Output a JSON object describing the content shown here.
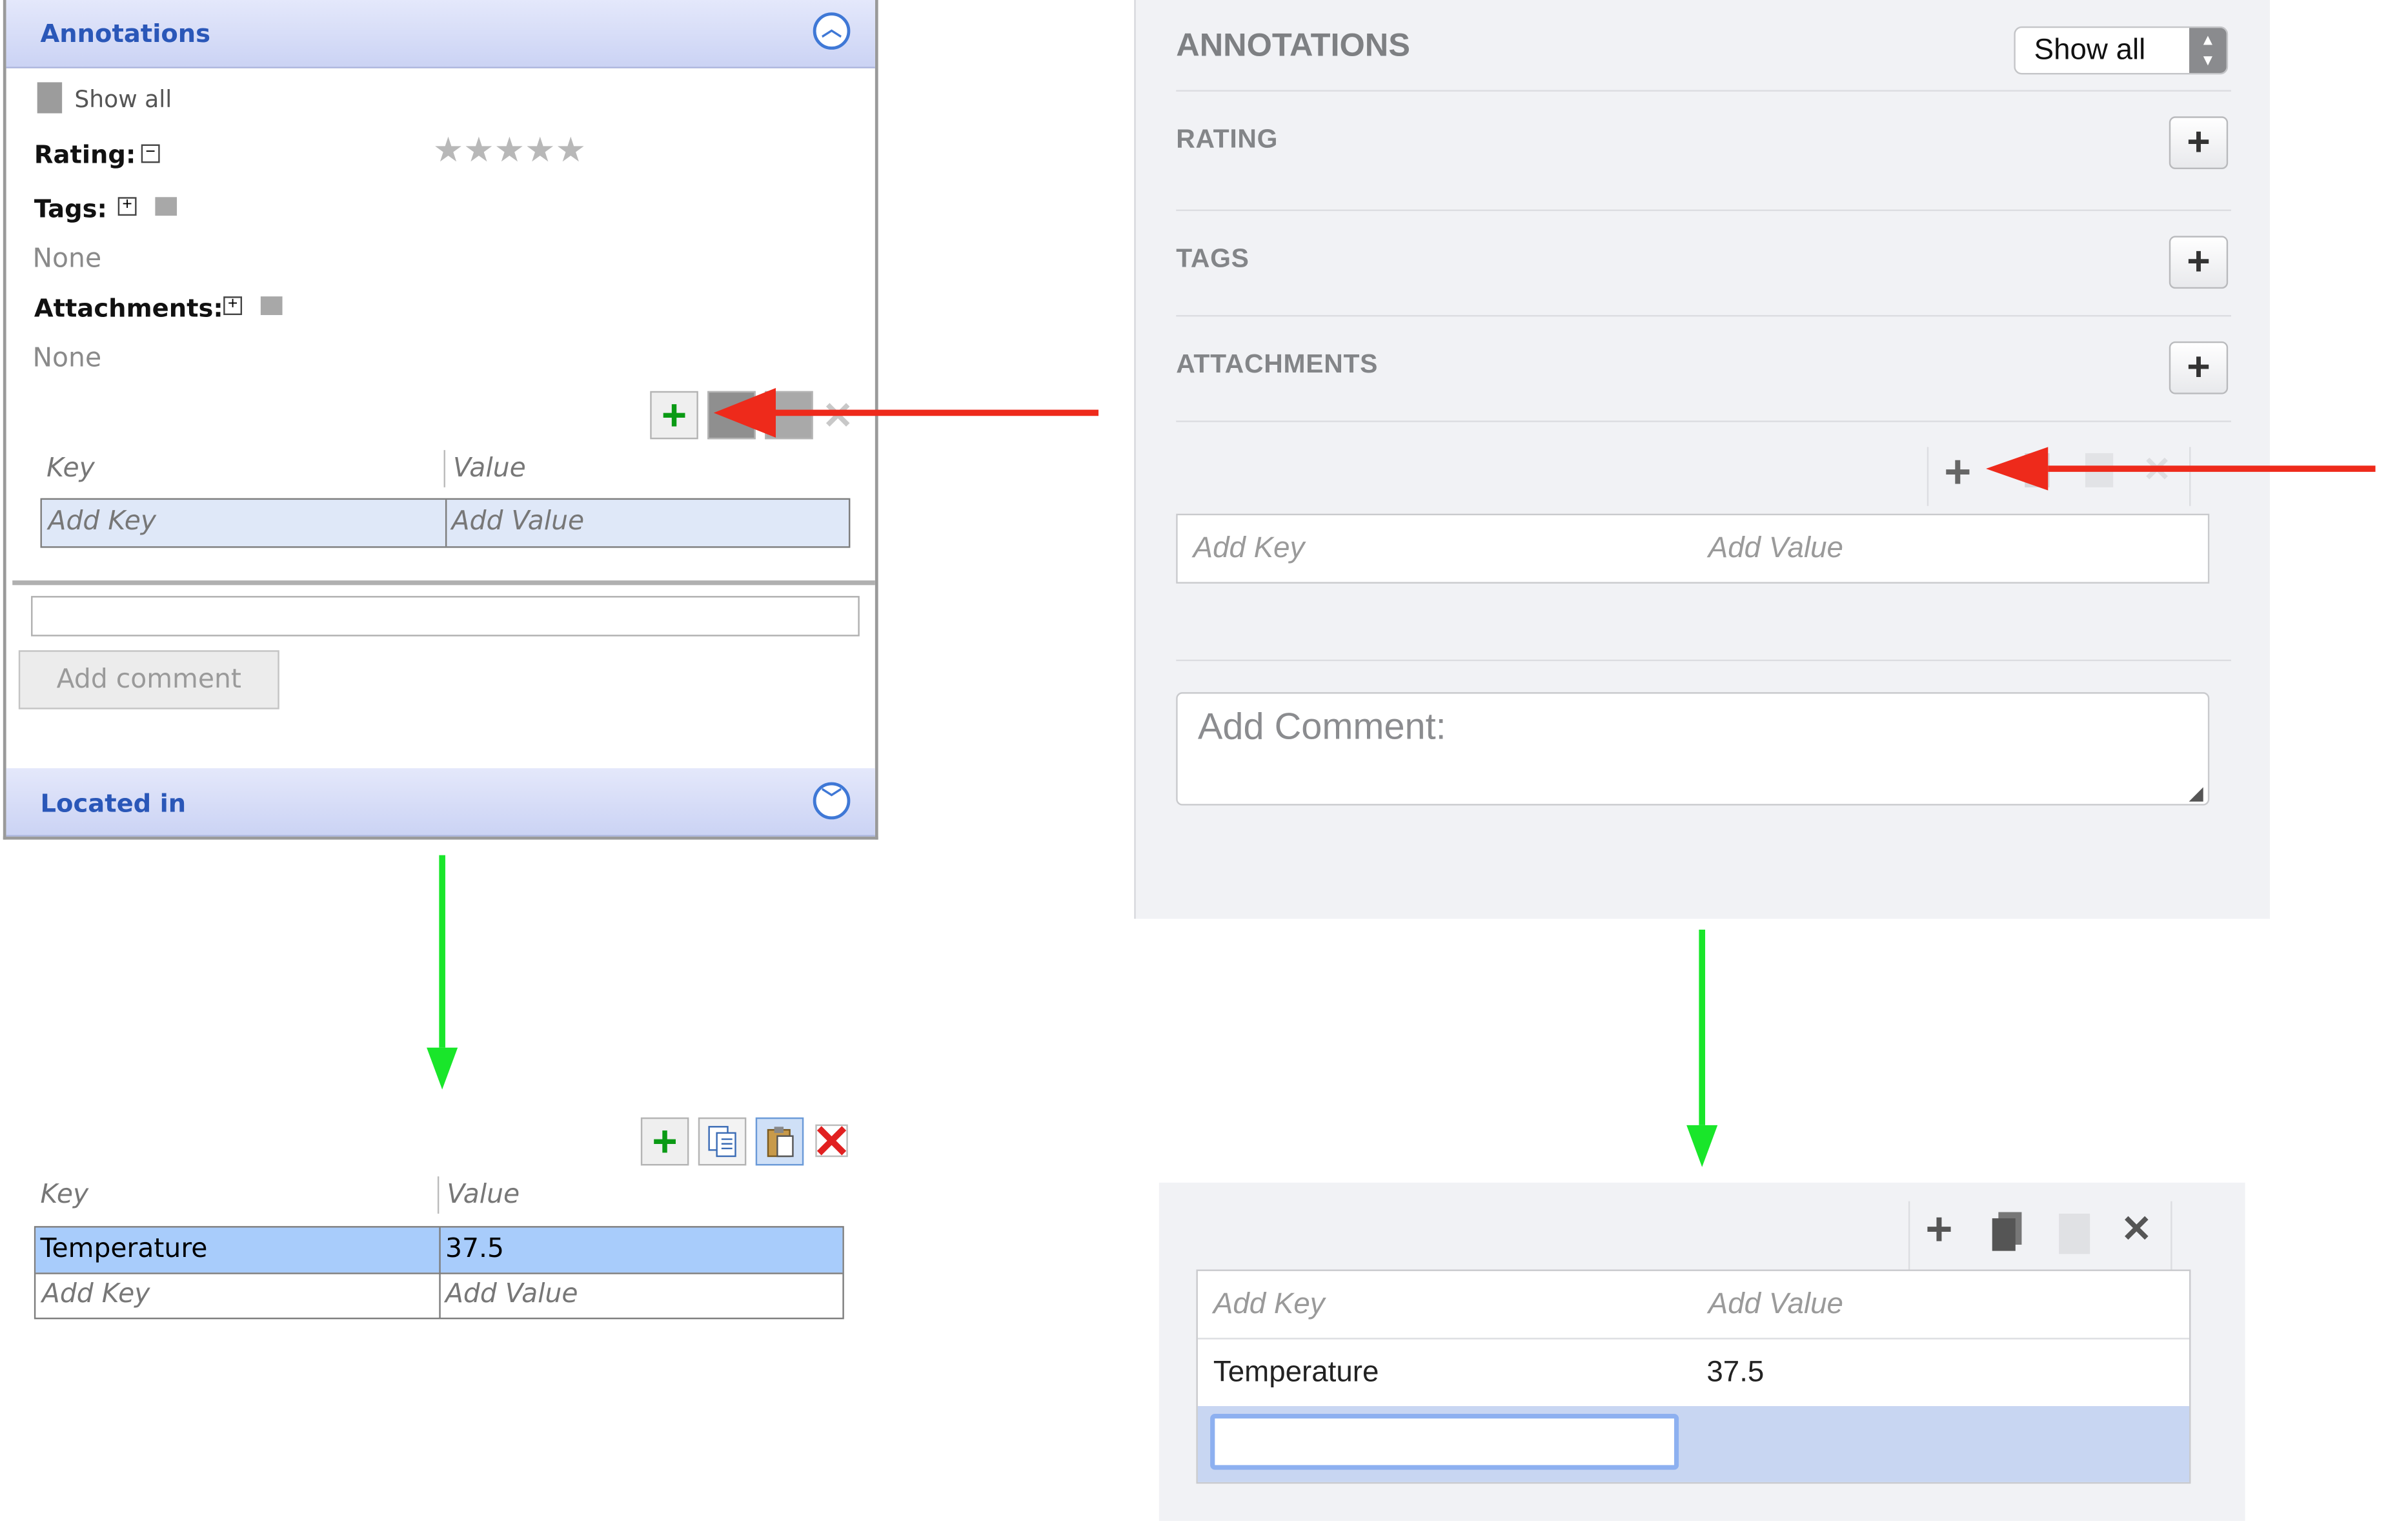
{
  "old_ui": {
    "header_title": "Annotations",
    "show_all": "Show all",
    "rating_label": "Rating:",
    "rating_stars": 0,
    "tags_label": "Tags:",
    "tags_value": "None",
    "attachments_label": "Attachments:",
    "attachments_value": "None",
    "key_header": "Key",
    "value_header": "Value",
    "add_key": "Add Key",
    "add_value": "Add Value",
    "add_comment_button": "Add comment",
    "located_in": "Located in",
    "after": {
      "key_header": "Key",
      "value_header": "Value",
      "row_key": "Temperature",
      "row_value": "37.5",
      "add_key": "Add Key",
      "add_value": "Add Value"
    }
  },
  "new_ui": {
    "section_title": "ANNOTATIONS",
    "show_all_select": "Show all",
    "rating": "RATING",
    "tags": "TAGS",
    "attachments": "ATTACHMENTS",
    "add_key": "Add Key",
    "add_value": "Add Value",
    "comment_placeholder": "Add Comment:",
    "after": {
      "add_key": "Add Key",
      "add_value": "Add Value",
      "row_key": "Temperature",
      "row_value": "37.5"
    }
  },
  "colors": {
    "arrow_red": "#ee2a1b",
    "arrow_green": "#19e62a",
    "old_header_text": "#2a57b8",
    "new_panel_bg": "#f1f2f5"
  }
}
